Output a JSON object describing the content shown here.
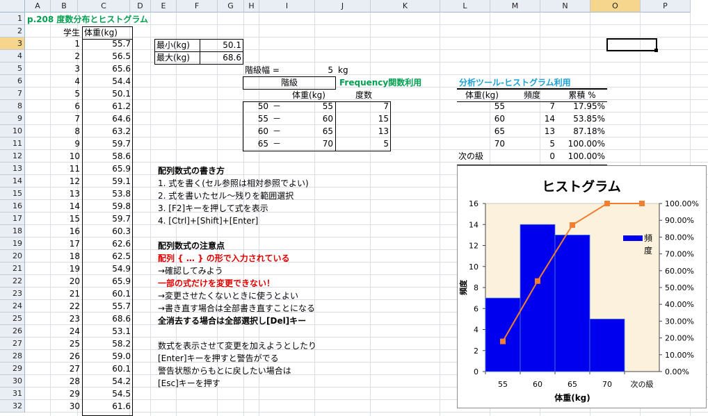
{
  "columns": [
    "A",
    "B",
    "C",
    "D",
    "E",
    "F",
    "G",
    "H",
    "I",
    "J",
    "K",
    "L",
    "M",
    "N",
    "O",
    "P"
  ],
  "selected_column": "O",
  "rows": [
    "1",
    "2",
    "3",
    "4",
    "5",
    "6",
    "7",
    "8",
    "9",
    "10",
    "11",
    "12",
    "13",
    "14",
    "15",
    "16",
    "17",
    "18",
    "19",
    "20",
    "21",
    "22",
    "23",
    "24",
    "25",
    "26",
    "27",
    "28",
    "29",
    "30",
    "31",
    "32"
  ],
  "title": "p.208 度数分布とヒストグラム",
  "data_header": {
    "student": "学生",
    "weight": "体重(kg)"
  },
  "students": [
    "1",
    "2",
    "3",
    "4",
    "5",
    "6",
    "7",
    "8",
    "9",
    "10",
    "11",
    "12",
    "13",
    "14",
    "15",
    "16",
    "17",
    "18",
    "19",
    "20",
    "21",
    "22",
    "23",
    "24",
    "25",
    "26",
    "27",
    "28",
    "29",
    "30"
  ],
  "weights": [
    "55.7",
    "56.5",
    "65.6",
    "54.4",
    "50.1",
    "61.2",
    "64.6",
    "63.2",
    "59.7",
    "58.6",
    "65.9",
    "59.1",
    "53.8",
    "59.8",
    "59.7",
    "60.3",
    "62.6",
    "62.5",
    "54.9",
    "65.9",
    "60.1",
    "55.7",
    "68.6",
    "53.1",
    "58.2",
    "59.0",
    "60.1",
    "54.2",
    "54.5",
    "61.6"
  ],
  "minmax": {
    "min_label": "最小(kg)",
    "min_value": "50.1",
    "max_label": "最大(kg)",
    "max_value": "68.6"
  },
  "class_width": {
    "label": "階級幅 =",
    "value": "5",
    "unit": "kg"
  },
  "freq_table": {
    "caption": "Frequency関数利用",
    "class_header": "階級",
    "weight_header": "体重(kg)",
    "count_header": "度数",
    "rows": [
      {
        "lower": "50",
        "dash": "－",
        "upper": "55",
        "count": "7"
      },
      {
        "lower": "55",
        "dash": "－",
        "upper": "60",
        "count": "15"
      },
      {
        "lower": "60",
        "dash": "－",
        "upper": "65",
        "count": "13"
      },
      {
        "lower": "65",
        "dash": "－",
        "upper": "70",
        "count": "5"
      }
    ]
  },
  "analysis": {
    "caption": "分析ツール-ヒストグラム利用",
    "headers": [
      "体重(kg)",
      "頻度",
      "累積 %"
    ],
    "rows": [
      [
        "55",
        "7",
        "17.95%"
      ],
      [
        "60",
        "14",
        "53.85%"
      ],
      [
        "65",
        "13",
        "87.18%"
      ],
      [
        "70",
        "5",
        "100.00%"
      ],
      [
        "次の級",
        "0",
        "100.00%"
      ]
    ]
  },
  "notes": {
    "how_title": "配列数式の書き方",
    "how_steps": [
      "1. 式を書く(セル参照は相対参照でよい)",
      "2. 式を書いたセル～残りを範囲選択",
      "3. [F2]キーを押して式を表示",
      "4. [Ctrl]+[Shift]+[Enter]"
    ],
    "caution_title": "配列数式の注意点",
    "caution_red1": "配列 { … } の形で入力されている",
    "caution_line2": "→確認してみよう",
    "caution_red2": "一部の式だけを変更できない！",
    "caution_line4": "→変更させたくないときに使うとよい",
    "caution_line5": "→書き直す場合は全部書き直すことになる",
    "caution_bold": "全消去する場合は全部選択し[Del]キー",
    "tip_lines": [
      "数式を表示させて変更を加えようとしたり",
      "[Enter]キーを押すと警告がでる",
      "警告状態からもとに戻したい場合は",
      "[Esc]キーを押す"
    ]
  },
  "colors": {
    "bar": "#0000ee",
    "line": "#f08030",
    "plot_bg": "#fbf1dc"
  },
  "chart_data": {
    "type": "bar",
    "title": "ヒストグラム",
    "xlabel": "体重(kg)",
    "ylabel": "頻度",
    "categories": [
      "55",
      "60",
      "65",
      "70",
      "次の級"
    ],
    "series": [
      {
        "name": "頻度",
        "type": "bar",
        "values": [
          7,
          14,
          13,
          5,
          0
        ]
      },
      {
        "type": "line",
        "axis": "secondary",
        "values": [
          17.95,
          53.85,
          87.18,
          100.0,
          100.0
        ]
      }
    ],
    "ylim": [
      0,
      16
    ],
    "yticks": [
      "0",
      "2",
      "4",
      "6",
      "8",
      "10",
      "12",
      "14",
      "16"
    ],
    "y2lim": [
      0,
      100
    ],
    "y2ticks": [
      "0.00%",
      "10.00%",
      "20.00%",
      "30.00%",
      "40.00%",
      "50.00%",
      "60.00%",
      "70.00%",
      "80.00%",
      "90.00%",
      "100.00%"
    ],
    "legend": "right",
    "grid": false
  }
}
